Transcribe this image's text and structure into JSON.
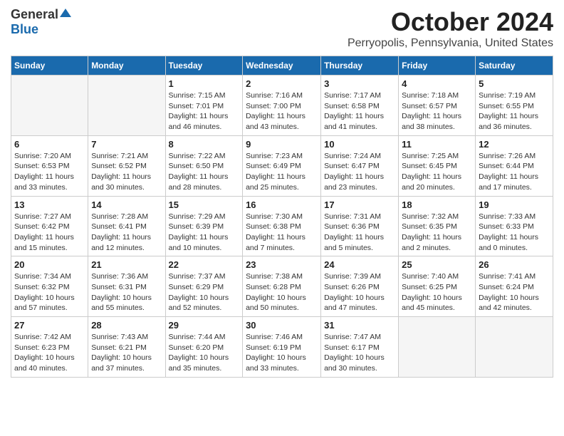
{
  "header": {
    "logo_general": "General",
    "logo_blue": "Blue",
    "month": "October 2024",
    "location": "Perryopolis, Pennsylvania, United States"
  },
  "weekdays": [
    "Sunday",
    "Monday",
    "Tuesday",
    "Wednesday",
    "Thursday",
    "Friday",
    "Saturday"
  ],
  "weeks": [
    [
      {
        "day": "",
        "empty": true
      },
      {
        "day": "",
        "empty": true
      },
      {
        "day": "1",
        "sunrise": "7:15 AM",
        "sunset": "7:01 PM",
        "daylight": "11 hours and 46 minutes."
      },
      {
        "day": "2",
        "sunrise": "7:16 AM",
        "sunset": "7:00 PM",
        "daylight": "11 hours and 43 minutes."
      },
      {
        "day": "3",
        "sunrise": "7:17 AM",
        "sunset": "6:58 PM",
        "daylight": "11 hours and 41 minutes."
      },
      {
        "day": "4",
        "sunrise": "7:18 AM",
        "sunset": "6:57 PM",
        "daylight": "11 hours and 38 minutes."
      },
      {
        "day": "5",
        "sunrise": "7:19 AM",
        "sunset": "6:55 PM",
        "daylight": "11 hours and 36 minutes."
      }
    ],
    [
      {
        "day": "6",
        "sunrise": "7:20 AM",
        "sunset": "6:53 PM",
        "daylight": "11 hours and 33 minutes."
      },
      {
        "day": "7",
        "sunrise": "7:21 AM",
        "sunset": "6:52 PM",
        "daylight": "11 hours and 30 minutes."
      },
      {
        "day": "8",
        "sunrise": "7:22 AM",
        "sunset": "6:50 PM",
        "daylight": "11 hours and 28 minutes."
      },
      {
        "day": "9",
        "sunrise": "7:23 AM",
        "sunset": "6:49 PM",
        "daylight": "11 hours and 25 minutes."
      },
      {
        "day": "10",
        "sunrise": "7:24 AM",
        "sunset": "6:47 PM",
        "daylight": "11 hours and 23 minutes."
      },
      {
        "day": "11",
        "sunrise": "7:25 AM",
        "sunset": "6:45 PM",
        "daylight": "11 hours and 20 minutes."
      },
      {
        "day": "12",
        "sunrise": "7:26 AM",
        "sunset": "6:44 PM",
        "daylight": "11 hours and 17 minutes."
      }
    ],
    [
      {
        "day": "13",
        "sunrise": "7:27 AM",
        "sunset": "6:42 PM",
        "daylight": "11 hours and 15 minutes."
      },
      {
        "day": "14",
        "sunrise": "7:28 AM",
        "sunset": "6:41 PM",
        "daylight": "11 hours and 12 minutes."
      },
      {
        "day": "15",
        "sunrise": "7:29 AM",
        "sunset": "6:39 PM",
        "daylight": "11 hours and 10 minutes."
      },
      {
        "day": "16",
        "sunrise": "7:30 AM",
        "sunset": "6:38 PM",
        "daylight": "11 hours and 7 minutes."
      },
      {
        "day": "17",
        "sunrise": "7:31 AM",
        "sunset": "6:36 PM",
        "daylight": "11 hours and 5 minutes."
      },
      {
        "day": "18",
        "sunrise": "7:32 AM",
        "sunset": "6:35 PM",
        "daylight": "11 hours and 2 minutes."
      },
      {
        "day": "19",
        "sunrise": "7:33 AM",
        "sunset": "6:33 PM",
        "daylight": "11 hours and 0 minutes."
      }
    ],
    [
      {
        "day": "20",
        "sunrise": "7:34 AM",
        "sunset": "6:32 PM",
        "daylight": "10 hours and 57 minutes."
      },
      {
        "day": "21",
        "sunrise": "7:36 AM",
        "sunset": "6:31 PM",
        "daylight": "10 hours and 55 minutes."
      },
      {
        "day": "22",
        "sunrise": "7:37 AM",
        "sunset": "6:29 PM",
        "daylight": "10 hours and 52 minutes."
      },
      {
        "day": "23",
        "sunrise": "7:38 AM",
        "sunset": "6:28 PM",
        "daylight": "10 hours and 50 minutes."
      },
      {
        "day": "24",
        "sunrise": "7:39 AM",
        "sunset": "6:26 PM",
        "daylight": "10 hours and 47 minutes."
      },
      {
        "day": "25",
        "sunrise": "7:40 AM",
        "sunset": "6:25 PM",
        "daylight": "10 hours and 45 minutes."
      },
      {
        "day": "26",
        "sunrise": "7:41 AM",
        "sunset": "6:24 PM",
        "daylight": "10 hours and 42 minutes."
      }
    ],
    [
      {
        "day": "27",
        "sunrise": "7:42 AM",
        "sunset": "6:23 PM",
        "daylight": "10 hours and 40 minutes."
      },
      {
        "day": "28",
        "sunrise": "7:43 AM",
        "sunset": "6:21 PM",
        "daylight": "10 hours and 37 minutes."
      },
      {
        "day": "29",
        "sunrise": "7:44 AM",
        "sunset": "6:20 PM",
        "daylight": "10 hours and 35 minutes."
      },
      {
        "day": "30",
        "sunrise": "7:46 AM",
        "sunset": "6:19 PM",
        "daylight": "10 hours and 33 minutes."
      },
      {
        "day": "31",
        "sunrise": "7:47 AM",
        "sunset": "6:17 PM",
        "daylight": "10 hours and 30 minutes."
      },
      {
        "day": "",
        "empty": true
      },
      {
        "day": "",
        "empty": true
      }
    ]
  ]
}
